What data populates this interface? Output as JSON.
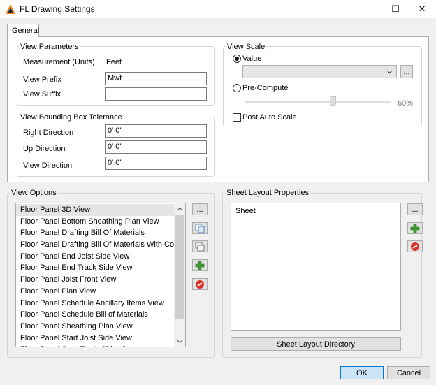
{
  "window": {
    "title": "FL Drawing Settings",
    "minimize_glyph": "—",
    "maximize_glyph": "☐",
    "close_glyph": "✕"
  },
  "tabs": [
    {
      "label": "General",
      "selected": true
    }
  ],
  "view_parameters": {
    "title": "View Parameters",
    "units_label": "Measurement (Units)",
    "units_value": "Feet",
    "prefix_label": "View Prefix",
    "prefix_value": "Mwf",
    "suffix_label": "View Suffix",
    "suffix_value": ""
  },
  "bounding_box": {
    "title": "View Bounding Box Tolerance",
    "right_label": "Right Direction",
    "right_value": "0'  0\"",
    "up_label": "Up Direction",
    "up_value": "0'  0\"",
    "view_label": "View Direction",
    "view_value": "0'  0\""
  },
  "view_scale": {
    "title": "View Scale",
    "value_label": "Value",
    "value_selected": true,
    "combo_value": "",
    "browse_label": "...",
    "precompute_label": "Pre-Compute",
    "slider_percent": 60,
    "slider_text": "60%",
    "post_auto_label": "Post Auto Scale",
    "post_auto_checked": false
  },
  "view_options": {
    "title": "View Options",
    "items": [
      "Floor Panel 3D View",
      "Floor Panel Bottom Sheathing Plan View",
      "Floor Panel Drafting Bill Of Materials",
      "Floor Panel Drafting Bill Of Materials With Colors",
      "Floor Panel End Joist Side View",
      "Floor Panel End Track Side View",
      "Floor Panel Joist Front View",
      "Floor Panel Plan View",
      "Floor Panel Schedule Ancillary Items View",
      "Floor Panel Schedule Bill of Materials",
      "Floor Panel Sheathing Plan View",
      "Floor Panel Start Joist Side View",
      "Floor Panel Start Track Side View"
    ],
    "more_label": "..."
  },
  "sheet_layout": {
    "title": "Sheet Layout Properties",
    "items": [
      "Sheet"
    ],
    "more_label": "...",
    "directory_label": "Sheet Layout Directory"
  },
  "footer": {
    "ok_label": "OK",
    "cancel_label": "Cancel"
  },
  "colors": {
    "accent": "#0078d7",
    "add_green": "#3c9a2e",
    "remove_red": "#d93025"
  }
}
